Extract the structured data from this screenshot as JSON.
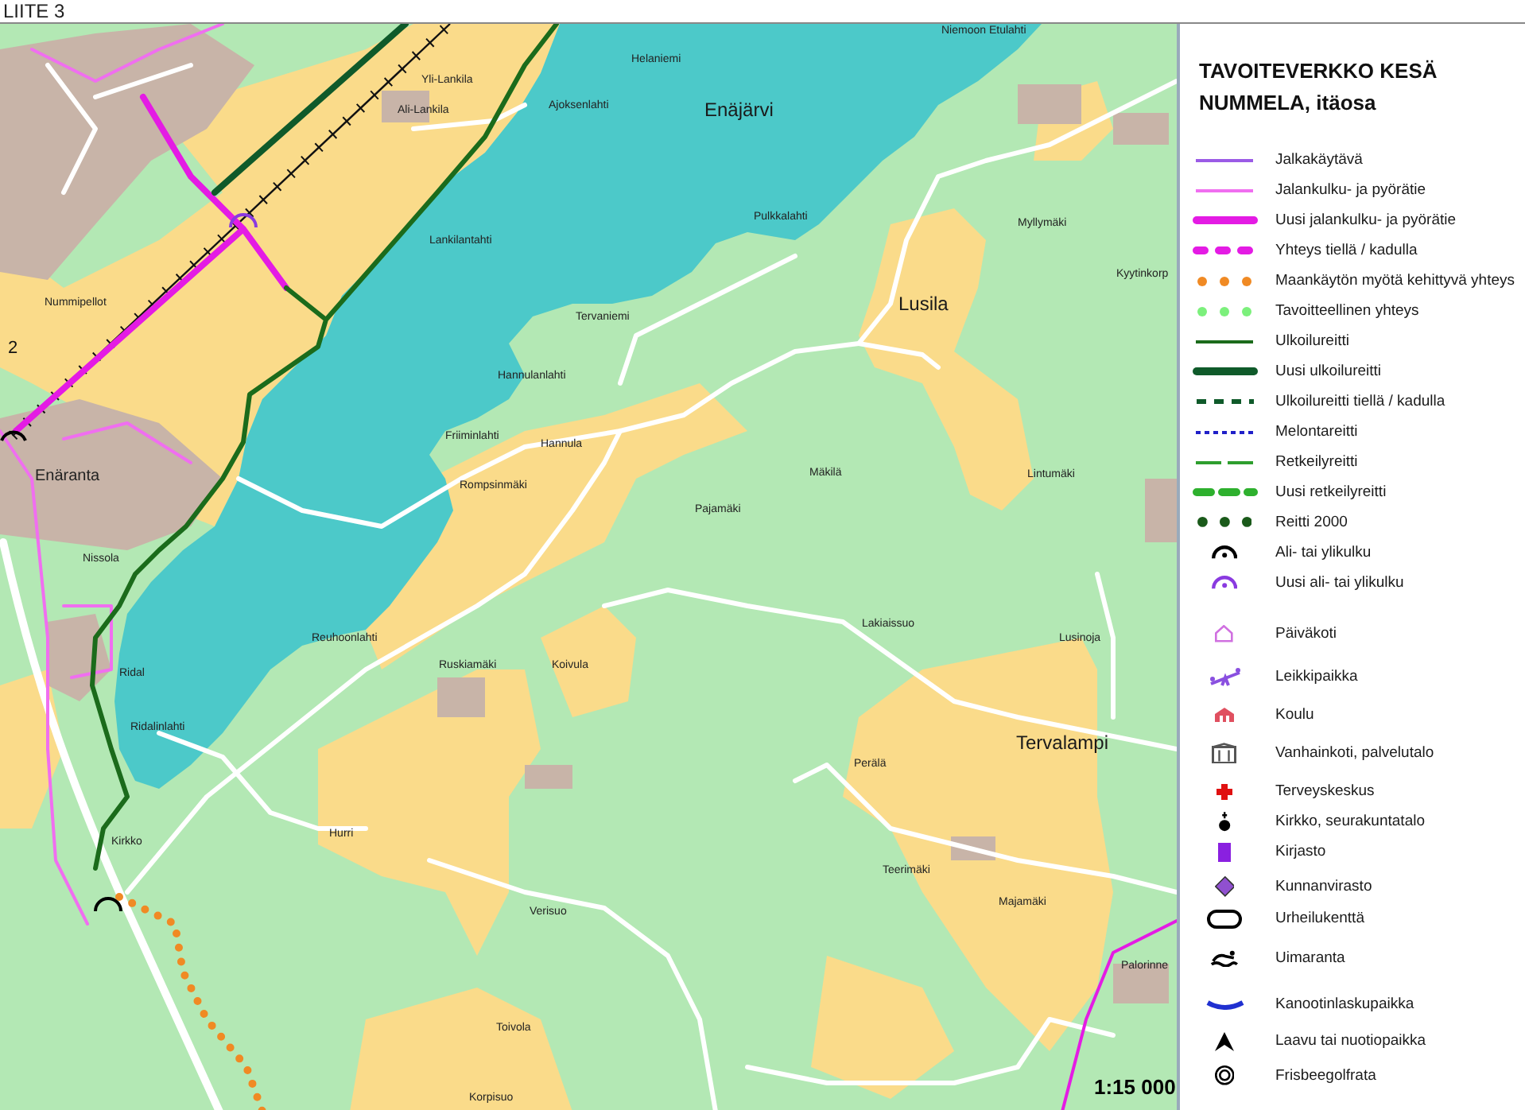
{
  "header": "LIITE 3",
  "map": {
    "place_labels": [
      {
        "text": "Yli-Lankila",
        "kind": "place"
      },
      {
        "text": "Ali-Lankila",
        "kind": "place"
      },
      {
        "text": "Ajoksenlahti",
        "kind": "place"
      },
      {
        "text": "Helaniemi",
        "kind": "place"
      },
      {
        "text": "Enäjärvi",
        "kind": "major"
      },
      {
        "text": "Niemoon Etulahti",
        "kind": "place"
      },
      {
        "text": "Pulkkalahti",
        "kind": "place"
      },
      {
        "text": "Myllymäki",
        "kind": "place"
      },
      {
        "text": "Kyytinkorp",
        "kind": "place"
      },
      {
        "text": "Lankilantahti",
        "kind": "place"
      },
      {
        "text": "Nummipellot",
        "kind": "place"
      },
      {
        "text": "Tervaniemi",
        "kind": "place"
      },
      {
        "text": "Lusila",
        "kind": "major"
      },
      {
        "text": "Hannulanlahti",
        "kind": "place"
      },
      {
        "text": "Friiminlahti",
        "kind": "place"
      },
      {
        "text": "Hannula",
        "kind": "place"
      },
      {
        "text": "Rompsinmäki",
        "kind": "place"
      },
      {
        "text": "Mäkilä",
        "kind": "place"
      },
      {
        "text": "Lintumäki",
        "kind": "place"
      },
      {
        "text": "Pajamäki",
        "kind": "place"
      },
      {
        "text": "Enäranta",
        "kind": "town"
      },
      {
        "text": "Nissola",
        "kind": "place"
      },
      {
        "text": "Reuhoonlahti",
        "kind": "place"
      },
      {
        "text": "Lakiaissuo",
        "kind": "place"
      },
      {
        "text": "Lusinoja",
        "kind": "place"
      },
      {
        "text": "Ruskiamäki",
        "kind": "place"
      },
      {
        "text": "Koivula",
        "kind": "place"
      },
      {
        "text": "Ridal",
        "kind": "place"
      },
      {
        "text": "Ridalinlahti",
        "kind": "place"
      },
      {
        "text": "Tervalampi",
        "kind": "major"
      },
      {
        "text": "Perälä",
        "kind": "place"
      },
      {
        "text": "Kirkko",
        "kind": "place"
      },
      {
        "text": "Hurri",
        "kind": "place"
      },
      {
        "text": "Teerimäki",
        "kind": "place"
      },
      {
        "text": "Majamäki",
        "kind": "place"
      },
      {
        "text": "Verisuo",
        "kind": "place"
      },
      {
        "text": "Palorinne",
        "kind": "place"
      },
      {
        "text": "Toivola",
        "kind": "place"
      },
      {
        "text": "Korpisuo",
        "kind": "place"
      },
      {
        "text": "2",
        "kind": "number"
      }
    ],
    "scale": "1:15 000"
  },
  "legend": {
    "title": "TAVOITEVERKKO KESÄ",
    "subtitle": "NUMMELA, itäosa",
    "items": [
      {
        "label": "Jalkakäytävä",
        "kind": "line",
        "color": "#9b5be6"
      },
      {
        "label": "Jalankulku- ja pyörätie",
        "kind": "line",
        "color": "#f06ef0"
      },
      {
        "label": "Uusi jalankulku- ja pyörätie",
        "kind": "thick",
        "color": "#e41be4"
      },
      {
        "label": "Yhteys tiellä / kadulla",
        "kind": "dash",
        "color": "#e41be4"
      },
      {
        "label": "Maankäytön myötä kehittyvä yhteys",
        "kind": "dots",
        "color": "#f08a24"
      },
      {
        "label": "Tavoitteellinen yhteys",
        "kind": "dots",
        "color": "#7cf07c"
      },
      {
        "label": "Ulkoilureitti",
        "kind": "line",
        "color": "#1b6b1b"
      },
      {
        "label": "Uusi ulkoilureitti",
        "kind": "thick",
        "color": "#0f5a2a"
      },
      {
        "label": "Ulkoilureitti tiellä / kadulla",
        "kind": "dashed",
        "color": "#0f5a2a"
      },
      {
        "label": "Melontareitti",
        "kind": "finedash",
        "color": "#2020c8"
      },
      {
        "label": "Retkeilyreitti",
        "kind": "longdash",
        "color": "#2e9e2e"
      },
      {
        "label": "Uusi retkeilyreitti",
        "kind": "thicklongdash",
        "color": "#2eb02e"
      },
      {
        "label": "Reitti 2000",
        "kind": "bigdots",
        "color": "#1a5a1a"
      },
      {
        "label": "Ali- tai ylikulku",
        "kind": "arc",
        "color": "#000000"
      },
      {
        "label": "Uusi ali- tai ylikulku",
        "kind": "arc",
        "color": "#8a3ae0"
      },
      {
        "label": "Päiväkoti",
        "kind": "house",
        "color": "#d070e0"
      },
      {
        "label": "Leikkipaikka",
        "kind": "seesaw",
        "color": "#8a50e0"
      },
      {
        "label": "Koulu",
        "kind": "school",
        "color": "#e05060"
      },
      {
        "label": "Vanhainkoti, palvelutalo",
        "kind": "carehome",
        "color": "#555555"
      },
      {
        "label": "Terveyskeskus",
        "kind": "cross",
        "color": "#e01010"
      },
      {
        "label": "Kirkko, seurakuntatalo",
        "kind": "church",
        "color": "#000000"
      },
      {
        "label": "Kirjasto",
        "kind": "book",
        "color": "#8a20e0"
      },
      {
        "label": "Kunnanvirasto",
        "kind": "diamond",
        "color": "#9050d0"
      },
      {
        "label": "Urheilukenttä",
        "kind": "stadium",
        "color": "#000000"
      },
      {
        "label": "Uimaranta",
        "kind": "swimmer",
        "color": "#000000"
      },
      {
        "label": "Kanootinlaskupaikka",
        "kind": "canoe",
        "color": "#2030d0"
      },
      {
        "label": "Laavu tai nuotiopaikka",
        "kind": "tent",
        "color": "#000000"
      },
      {
        "label": "Frisbeegolfrata",
        "kind": "rings",
        "color": "#000000"
      }
    ]
  }
}
